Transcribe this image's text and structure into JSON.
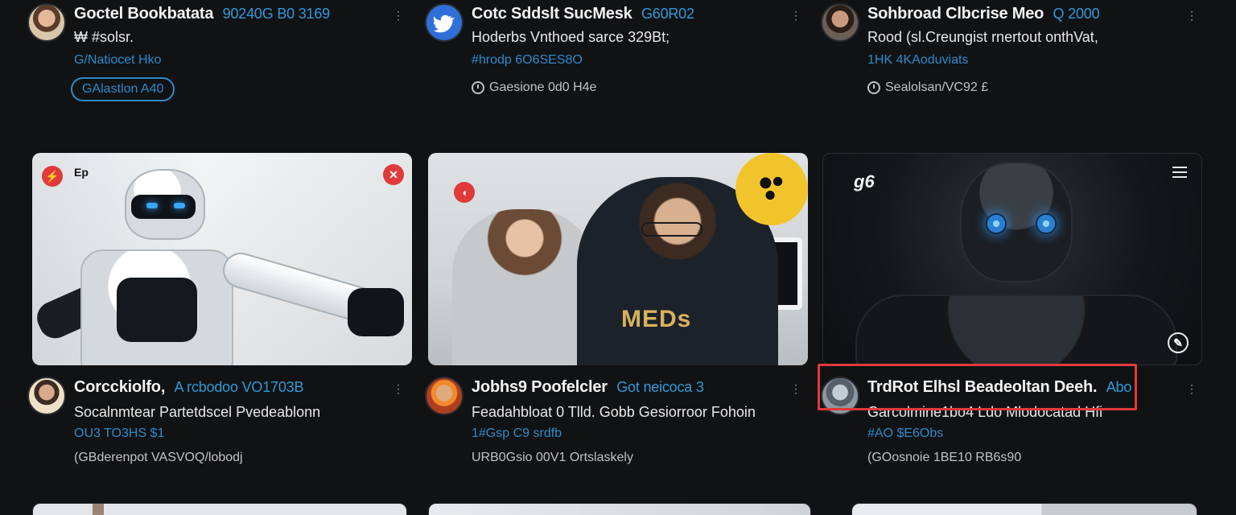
{
  "top_posts": [
    {
      "avatar_icon": "person-avatar-icon",
      "title": "Goctel Bookbatata",
      "handle": "90240G B0 3169",
      "line2": "₩ #solsr.",
      "line3": "G/Natiocet Hko",
      "pill": "GAlastlon A40"
    },
    {
      "avatar_icon": "bird-avatar-icon",
      "title": "Cotc Sddslt SucMesk",
      "handle": "G60R02",
      "line2": "Hoderbs Vnthoed sarce 329Bt;",
      "line3": "#hrodp 6O6SES8O",
      "line4": "Gaesione 0d0 H4e"
    },
    {
      "avatar_icon": "person-avatar-icon",
      "title": "Sohbroad Clbcrise Meo",
      "handle": "Q 2000",
      "line2": "Rood (sl.Creungist rnertout onthVat,",
      "line3": "1HK 4KAoduviats",
      "line4": "Sealolsan/VC92 £"
    }
  ],
  "media_cards": [
    {
      "top_left_label": "Ep",
      "icon_left": "lightning-icon",
      "icon_right": "close-icon"
    },
    {
      "shirt_text": "MEDs",
      "badge_icon": "dots-icon",
      "icon_left": "headphones-icon"
    },
    {
      "top_left_label": "g6",
      "menu_icon": "menu-icon",
      "corner_icon": "pen-icon"
    }
  ],
  "info_posts": [
    {
      "avatar_icon": "person-avatar-icon",
      "title": "Corcckiolfo,",
      "handle": "A rcbodoo VO1703B",
      "line2": "Socalnmtear Partetdscel Pvedeablonn",
      "line3": "OU3 TO3HS $1",
      "line4": "(GBderenpot VASVOQ/lobodj"
    },
    {
      "avatar_icon": "person-avatar-icon",
      "title": "Jobhs9 Poofelcler",
      "handle": "Got neicoca 3",
      "line2": "Feadahbloat 0 Tlld. Gobb Gesiorroor Fohoin",
      "line3": "1#Gsp C9 srdfb",
      "line4": "URB0Gsio 00V1 Ortslaskely"
    },
    {
      "avatar_icon": "person-avatar-icon",
      "title": "TrdRot Elhsl Beadeoltan Deeh.",
      "handle": "Abo",
      "line2": "Garcolmine1bo4 Ldo Mlodocatad Hfi",
      "line3": "#AO $E6Obs",
      "line4": "(GOosnoie 1BE10 RB6s90"
    }
  ],
  "colors": {
    "background": "#111214",
    "accent": "#2e9ad8",
    "alert": "#e03a3a"
  }
}
